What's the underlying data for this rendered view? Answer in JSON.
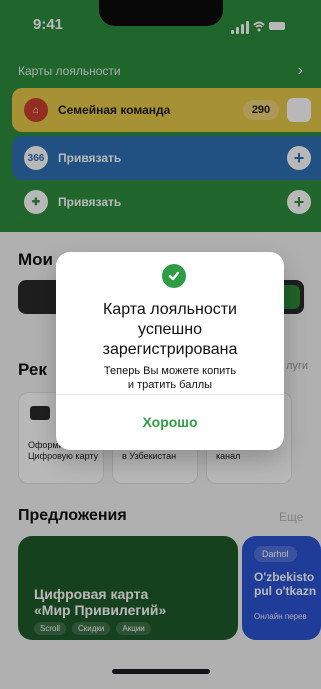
{
  "status_bar": {
    "time": "9:41"
  },
  "header": {
    "section_title": "Карты лояльности",
    "chevron": "›"
  },
  "cards": [
    {
      "title": "Семейная команда",
      "points": "290",
      "icon": "family-team-icon",
      "action": "qr-code-icon"
    },
    {
      "title": "Привязать",
      "logo": "366",
      "icon": "366-logo-icon",
      "action": "plus-icon"
    },
    {
      "title": "Привязать",
      "icon": "cross-logo-icon",
      "action": "plus-icon"
    }
  ],
  "sections": {
    "my_cards_title": "Мои",
    "services_title": "Рек",
    "services_more": "луги",
    "offers_title": "Предложения",
    "offers_more": "Еще"
  },
  "services": [
    {
      "label": "Оформить\nЦифровую карту",
      "icon": "card-icon"
    },
    {
      "label": "Переводы\nв Узбекистан",
      "icon": "transfer-icon"
    },
    {
      "label": "Телеграм\nканал",
      "icon": "telegram-icon"
    }
  ],
  "offers": [
    {
      "title": "Цифровая карта\n«Мир Привилегий»",
      "tags": [
        "Scroll",
        "Скидки",
        "Акции"
      ]
    },
    {
      "chip": "Darhol",
      "title": "O'zbekisto\npul o'tkazn",
      "subtitle": "Онлайн перев"
    }
  ],
  "modal": {
    "title": "Карта лояльности\nуспешно\nзарегистрирована",
    "subtitle": "Теперь Вы можете копить\nи тратить баллы",
    "ok_label": "Хорошо"
  },
  "colors": {
    "accent_green": "#2f9d46",
    "top_green": "#2c8c3e",
    "card_yellow": "#e7c94a",
    "card_blue": "#2f6fb4"
  }
}
